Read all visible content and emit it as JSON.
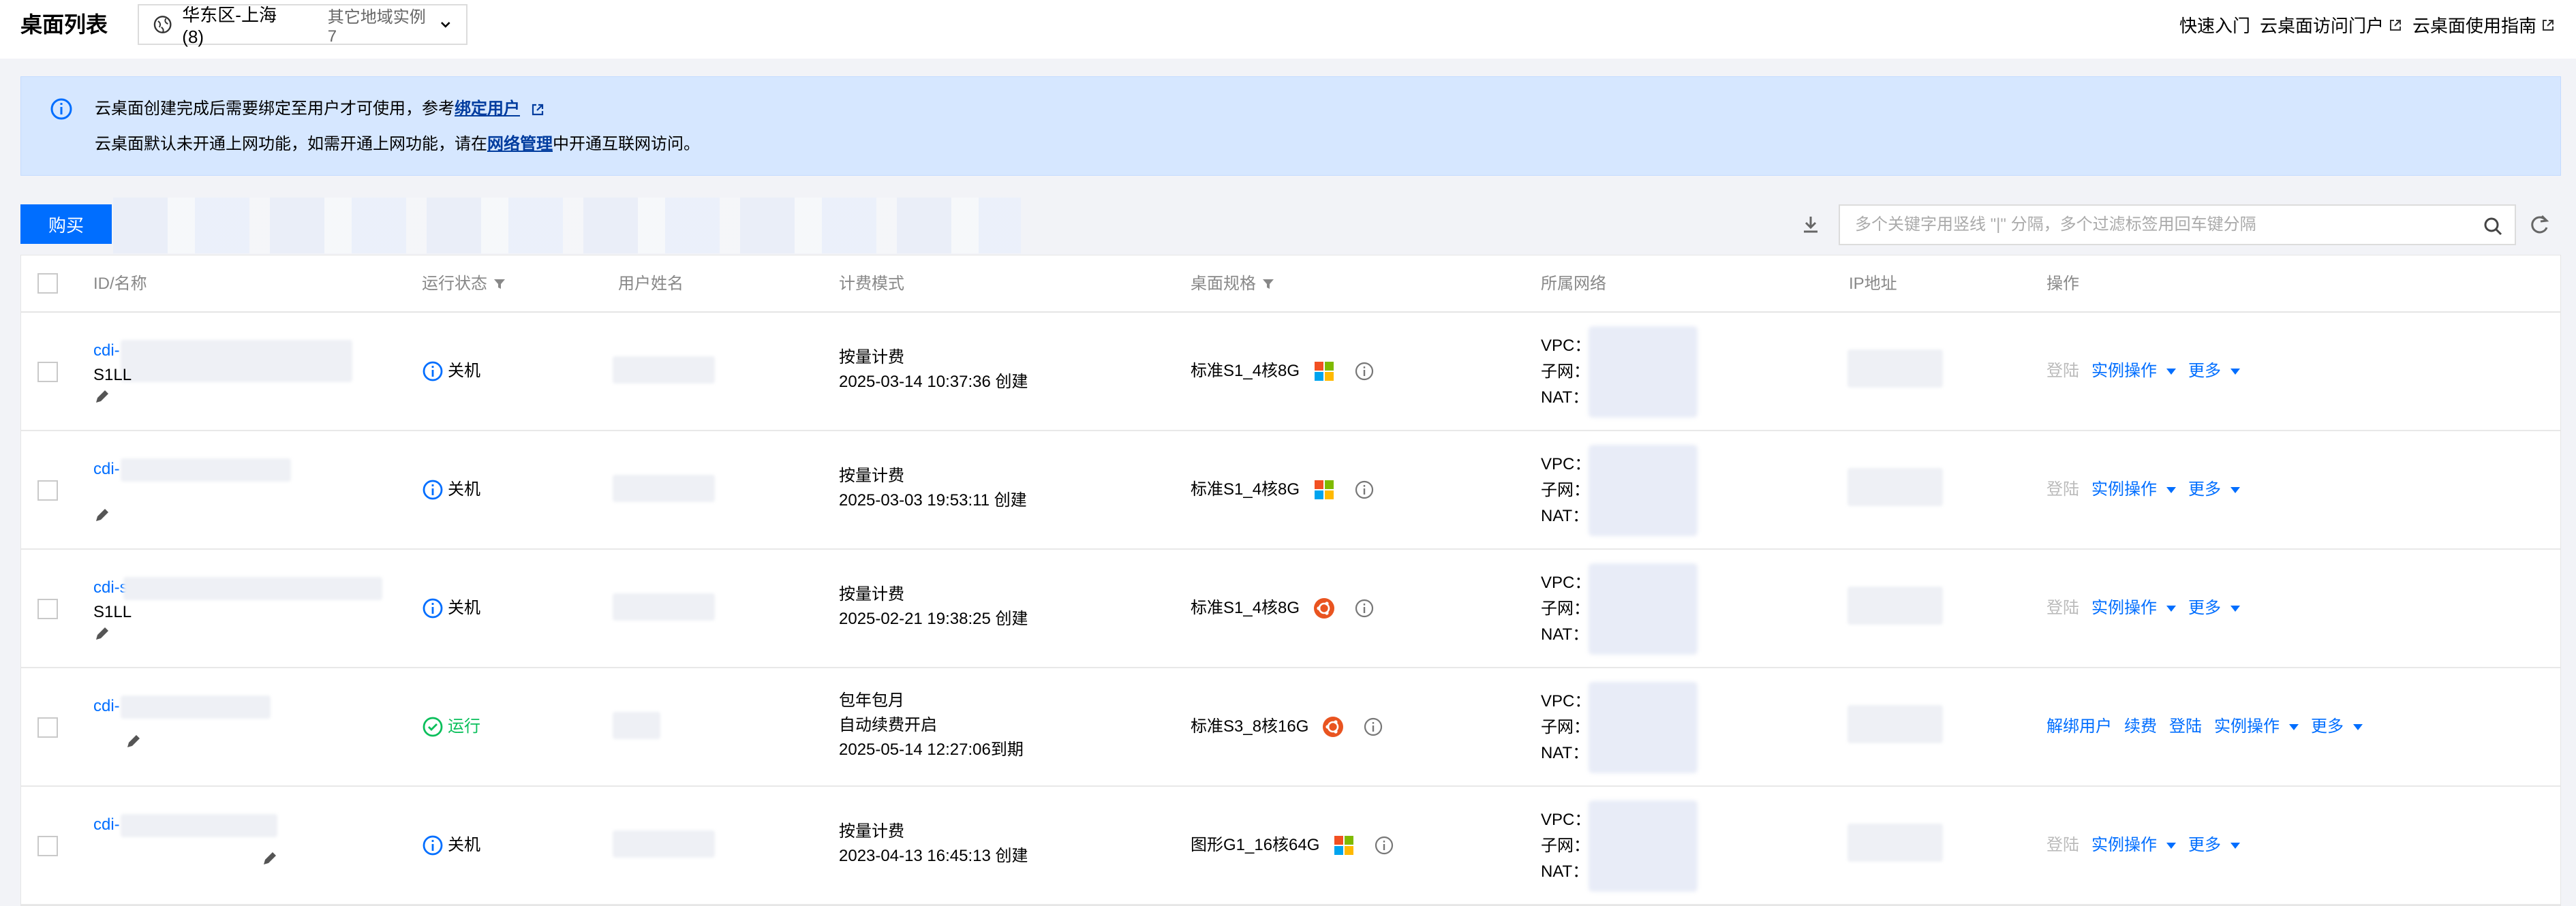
{
  "header": {
    "title": "桌面列表",
    "region": "华东区-上海 (8)",
    "other_regions": "其它地域实例7",
    "links": [
      "快速入门",
      "云桌面访问门户",
      "云桌面使用指南"
    ]
  },
  "notice": {
    "line1_prefix": "云桌面创建完成后需要绑定至用户才可使用，参考",
    "line1_link": "绑定用户",
    "line2_prefix": "云桌面默认未开通上网功能，如需开通上网功能，请在",
    "line2_link": "网络管理",
    "line2_suffix": "中开通互联网访问。"
  },
  "toolbar": {
    "buy_label": "购买",
    "search_placeholder": "多个关键字用竖线 \"|\" 分隔，多个过滤标签用回车键分隔"
  },
  "table": {
    "columns": [
      "ID/名称",
      "运行状态",
      "用户姓名",
      "计费模式",
      "桌面规格",
      "所属网络",
      "IP地址",
      "操作"
    ],
    "net_labels": [
      "VPC：",
      "子网：",
      "NAT："
    ],
    "rows": [
      {
        "id": "cdi-",
        "name": "S1LL",
        "status": "关机",
        "billing": [
          "按量计费",
          "2025-03-14 10:37:36 创建"
        ],
        "spec": "标准S1_4核8G",
        "os": "windows-icon",
        "actions": [
          "登陆",
          "实例操作",
          "更多"
        ],
        "running": false
      },
      {
        "id": "cdi-",
        "name": "",
        "status": "关机",
        "billing": [
          "按量计费",
          "2025-03-03 19:53:11 创建"
        ],
        "spec": "标准S1_4核8G",
        "os": "windows-icon",
        "actions": [
          "登陆",
          "实例操作",
          "更多"
        ],
        "running": false
      },
      {
        "id": "cdi-s",
        "name": "S1LL",
        "status": "关机",
        "billing": [
          "按量计费",
          "2025-02-21 19:38:25 创建"
        ],
        "spec": "标准S1_4核8G",
        "os": "ubuntu-icon",
        "actions": [
          "登陆",
          "实例操作",
          "更多"
        ],
        "running": false
      },
      {
        "id": "cdi-",
        "name": "",
        "status": "运行",
        "billing": [
          "包年包月",
          "自动续费开启",
          "2025-05-14 12:27:06到期"
        ],
        "spec": "标准S3_8核16G",
        "os": "ubuntu-icon",
        "actions": [
          "解绑用户",
          "续费",
          "登陆",
          "实例操作",
          "更多"
        ],
        "running": true
      },
      {
        "id": "cdi-",
        "name": "",
        "status": "关机",
        "billing": [
          "按量计费",
          "2023-04-13 16:45:13 创建"
        ],
        "spec": "图形G1_16核64G",
        "os": "windows-icon",
        "actions": [
          "登陆",
          "实例操作",
          "更多"
        ],
        "running": false
      }
    ]
  }
}
